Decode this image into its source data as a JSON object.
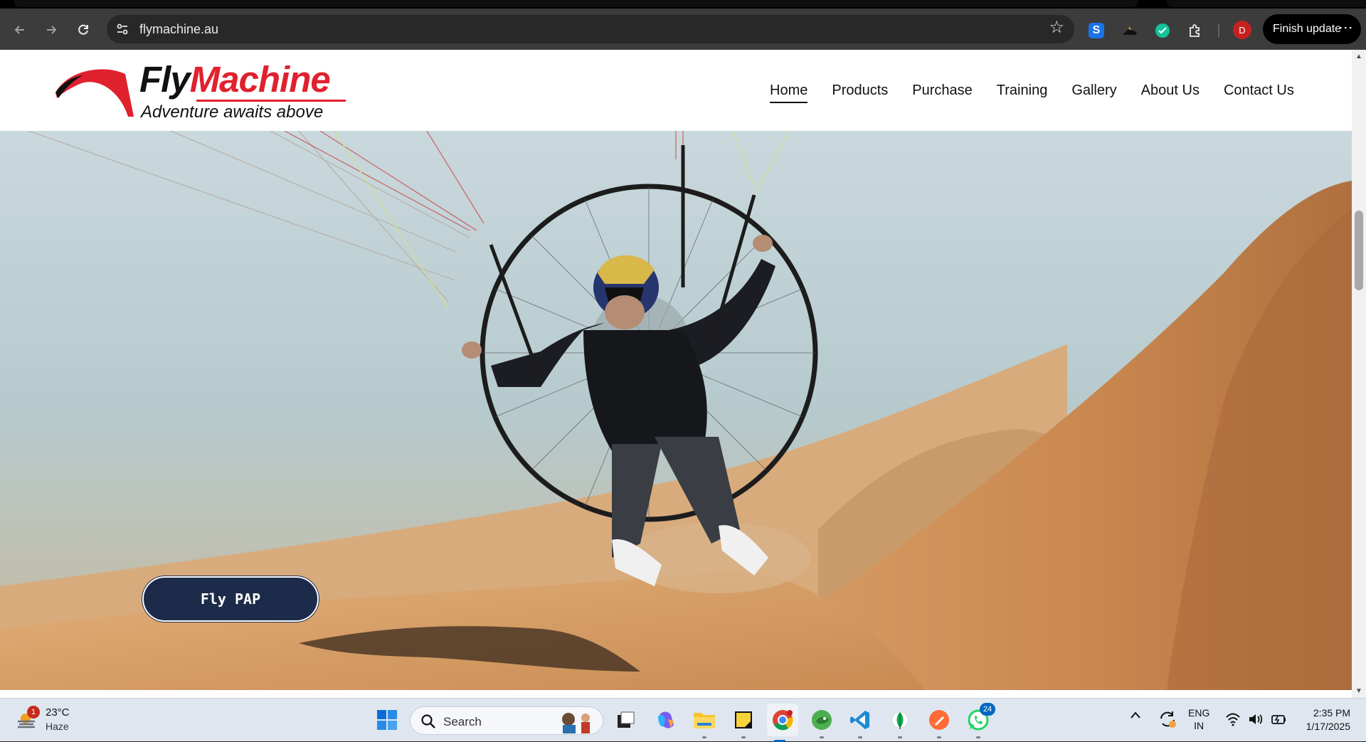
{
  "browser": {
    "url": "flymachine.au",
    "update_label": "Finish update",
    "profile_initial": "D",
    "icons": {
      "back": "arrow-left-icon",
      "forward": "arrow-right-icon",
      "reload": "reload-icon",
      "site_info": "site-info-icon",
      "bookmark": "star-icon",
      "extensions": "puzzle-icon",
      "menu": "kebab-menu-icon"
    }
  },
  "site": {
    "logo": {
      "brand_part1": "Fly",
      "brand_part2": "Machine",
      "tagline": "Adventure awaits above",
      "brand_color": "#e0212e"
    },
    "nav": [
      {
        "label": "Home",
        "active": true
      },
      {
        "label": "Products"
      },
      {
        "label": "Purchase"
      },
      {
        "label": "Training"
      },
      {
        "label": "Gallery"
      },
      {
        "label": "About Us"
      },
      {
        "label": "Contact Us"
      }
    ],
    "hero": {
      "cta_label": "Fly PAP",
      "cta_color": "#1c2b4a"
    }
  },
  "taskbar": {
    "weather": {
      "badge": "1",
      "temp": "23°C",
      "condition": "Haze"
    },
    "search_label": "Search",
    "apps": [
      "task-view",
      "copilot",
      "file-explorer",
      "sticky-notes",
      "chrome",
      "app-green",
      "vscode",
      "mongodb-compass",
      "postman",
      "whatsapp"
    ],
    "whatsapp_badge": "24",
    "lang_line1": "ENG",
    "lang_line2": "IN",
    "time": "2:35 PM",
    "date": "1/17/2025"
  }
}
